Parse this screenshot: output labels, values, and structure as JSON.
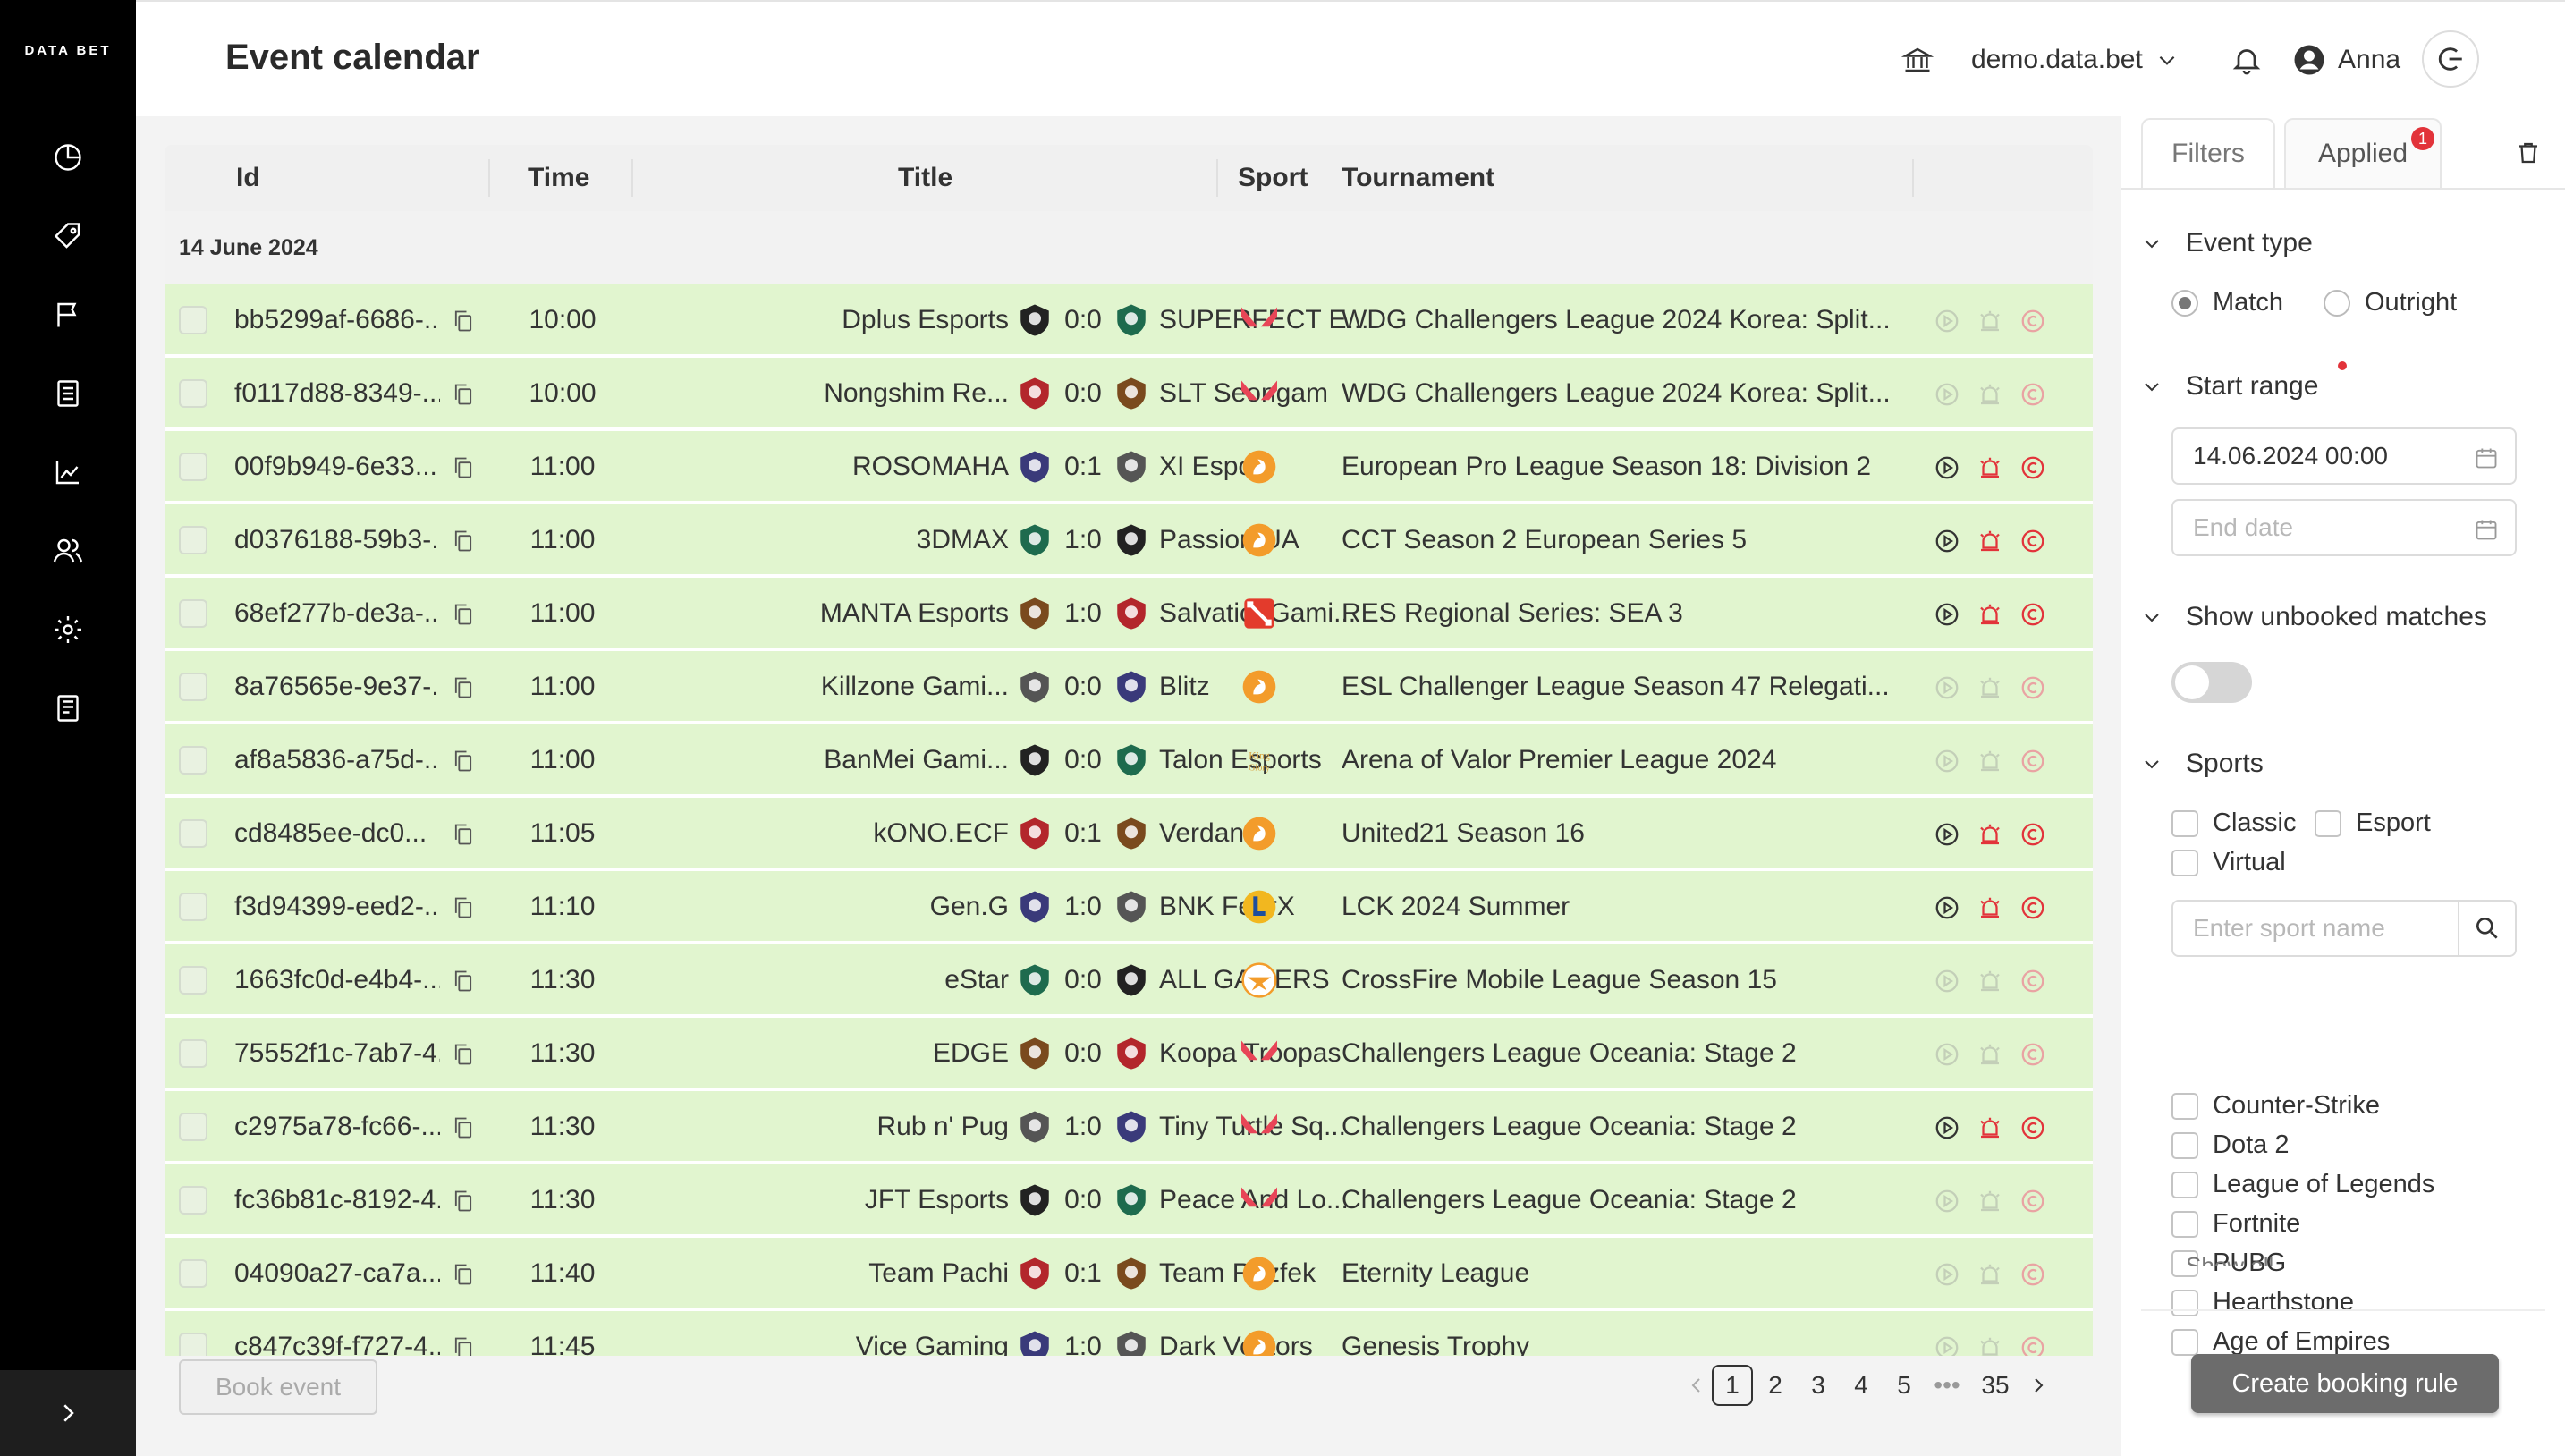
{
  "app": {
    "logo_text": "DATA BET",
    "page_title": "Event calendar"
  },
  "header": {
    "domain": "demo.data.bet",
    "user_name": "Anna"
  },
  "sidebar": {
    "items": [
      "dashboard-icon",
      "tag-icon",
      "flag-icon",
      "list-icon",
      "chart-icon",
      "users-icon",
      "settings-icon",
      "report-icon"
    ]
  },
  "table": {
    "columns": {
      "id": "Id",
      "time": "Time",
      "title": "Title",
      "sport": "Sport",
      "tournament": "Tournament"
    },
    "date_label": "14 June 2024",
    "rows": [
      {
        "id": "bb5299af-6686-...",
        "time": "10:00",
        "home": "Dplus Esports",
        "score": "0:0",
        "away": "SUPERFECT E...",
        "sport": "valorant-icon",
        "tournament": "WDG Challengers League 2024 Korea: Split...",
        "active": false
      },
      {
        "id": "f0117d88-8349-...",
        "time": "10:00",
        "home": "Nongshim Re...",
        "score": "0:0",
        "away": "SLT Seongam",
        "sport": "valorant-icon",
        "tournament": "WDG Challengers League 2024 Korea: Split...",
        "active": false
      },
      {
        "id": "00f9b949-6e33...",
        "time": "11:00",
        "home": "ROSOMAHA",
        "score": "0:1",
        "away": "XI Esport",
        "sport": "counter-strike-icon",
        "tournament": "European Pro League Season 18: Division 2",
        "active": true
      },
      {
        "id": "d0376188-59b3-...",
        "time": "11:00",
        "home": "3DMAX",
        "score": "1:0",
        "away": "Passion UA",
        "sport": "counter-strike-icon",
        "tournament": "CCT Season 2 European Series 5",
        "active": true
      },
      {
        "id": "68ef277b-de3a-...",
        "time": "11:00",
        "home": "MANTA Esports",
        "score": "1:0",
        "away": "SalvationGami...",
        "sport": "dota-icon",
        "tournament": "RES Regional Series: SEA 3",
        "active": true
      },
      {
        "id": "8a76565e-9e37-...",
        "time": "11:00",
        "home": "Killzone Gami...",
        "score": "0:0",
        "away": "Blitz",
        "sport": "counter-strike-icon",
        "tournament": "ESL Challenger League Season 47 Relegati...",
        "active": false
      },
      {
        "id": "af8a5836-a75d-...",
        "time": "11:00",
        "home": "BanMei Gami...",
        "score": "0:0",
        "away": "Talon Esports",
        "sport": "king-of-glory-icon",
        "tournament": "Arena of Valor Premier League 2024",
        "active": false
      },
      {
        "id": "cd8485ee-dc0...",
        "time": "11:05",
        "home": "kONO.ECF",
        "score": "0:1",
        "away": "Verdant",
        "sport": "counter-strike-icon",
        "tournament": "United21 Season 16",
        "active": true
      },
      {
        "id": "f3d94399-eed2-...",
        "time": "11:10",
        "home": "Gen.G",
        "score": "1:0",
        "away": "BNK FearX",
        "sport": "league-of-legends-icon",
        "tournament": "LCK 2024 Summer",
        "active": true
      },
      {
        "id": "1663fc0d-e4b4-...",
        "time": "11:30",
        "home": "eStar",
        "score": "0:0",
        "away": "ALL GAMERS",
        "sport": "crossfire-icon",
        "tournament": "CrossFire Mobile League Season 15",
        "active": false
      },
      {
        "id": "75552f1c-7ab7-4...",
        "time": "11:30",
        "home": "EDGE",
        "score": "0:0",
        "away": "Koopa Troopas",
        "sport": "valorant-icon",
        "tournament": "Challengers League Oceania: Stage 2",
        "active": false
      },
      {
        "id": "c2975a78-fc66-...",
        "time": "11:30",
        "home": "Rub n' Pug",
        "score": "1:0",
        "away": "Tiny Turtle Sq...",
        "sport": "valorant-icon",
        "tournament": "Challengers League Oceania: Stage 2",
        "active": true
      },
      {
        "id": "fc36b81c-8192-4...",
        "time": "11:30",
        "home": "JFT Esports",
        "score": "0:0",
        "away": "Peace And Lo...",
        "sport": "valorant-icon",
        "tournament": "Challengers League Oceania: Stage 2",
        "active": false
      },
      {
        "id": "04090a27-ca7a...",
        "time": "11:40",
        "home": "Team Pachi",
        "score": "0:1",
        "away": "Team Rozfek",
        "sport": "counter-strike-icon",
        "tournament": "Eternity League",
        "active": false
      },
      {
        "id": "c847c39f-f727-4...",
        "time": "11:45",
        "home": "Vice Gaming",
        "score": "1:0",
        "away": "Dark Vectors",
        "sport": "counter-strike-icon",
        "tournament": "Genesis Trophy",
        "active": false
      }
    ]
  },
  "footer": {
    "book_event_label": "Book event",
    "pages": [
      "1",
      "2",
      "3",
      "4",
      "5",
      "•••",
      "35"
    ],
    "current_page": "1"
  },
  "filters": {
    "tab_filters": "Filters",
    "tab_applied": "Applied",
    "applied_count": "1",
    "event_type": {
      "title": "Event type",
      "match": "Match",
      "outright": "Outright",
      "selected": "Match"
    },
    "start_range": {
      "title": "Start range",
      "start_value": "14.06.2024 00:00",
      "end_placeholder": "End date"
    },
    "unbooked": {
      "title": "Show unbooked matches",
      "enabled": false
    },
    "sports": {
      "title": "Sports",
      "classic": "Classic",
      "esport": "Esport",
      "virtual": "Virtual",
      "search_placeholder": "Enter sport name",
      "list": [
        "Counter-Strike",
        "Dota 2",
        "League of Legends",
        "Fortnite",
        "PUBG",
        "Hearthstone",
        "Age of Empires"
      ],
      "show_all": "Show all"
    },
    "create_rule_label": "Create booking rule"
  },
  "colors": {
    "row_bg": "#e1f5cf",
    "accent_red": "#e2333a",
    "valorant": "#e84557",
    "cs_orange": "#f39c2b",
    "sidebar": "#000000"
  }
}
